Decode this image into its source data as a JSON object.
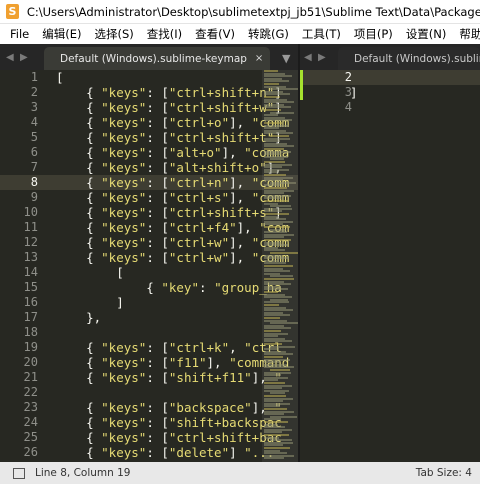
{
  "window": {
    "title": "C:\\Users\\Administrator\\Desktop\\sublimetextpj_jb51\\Sublime Text\\Data\\Packages\\Default\\D..."
  },
  "menu": [
    "File",
    "编辑(E)",
    "选择(S)",
    "查找(I)",
    "查看(V)",
    "转跳(G)",
    "工具(T)",
    "项目(P)",
    "设置(N)",
    "帮助(H)"
  ],
  "tabs": {
    "left": {
      "label": "Default (Windows).sublime-keymap",
      "close": "×"
    },
    "right": {
      "label": "Default (Windows).sublime-keym"
    },
    "arrows": {
      "left_prev": "◀",
      "left_next": "▶",
      "dropdown": "▼",
      "right_prev": "◀",
      "right_next": "▶"
    }
  },
  "left_pane": {
    "line_numbers": [
      "1",
      "2",
      "3",
      "4",
      "5",
      "6",
      "7",
      "8",
      "9",
      "10",
      "11",
      "12",
      "13",
      "14",
      "15",
      "16",
      "17",
      "18",
      "19",
      "20",
      "21",
      "22",
      "23",
      "24",
      "25",
      "26"
    ],
    "active_line": "8",
    "lines": [
      "[",
      "    { \"keys\": [\"ctrl+shift+n\"]",
      "    { \"keys\": [\"ctrl+shift+w\"]",
      "    { \"keys\": [\"ctrl+o\"], \"comm",
      "    { \"keys\": [\"ctrl+shift+t\"]",
      "    { \"keys\": [\"alt+o\"], \"comma",
      "    { \"keys\": [\"alt+shift+o\"],",
      "    { \"keys\": [\"ctrl+n\"], \"comm",
      "    { \"keys\": [\"ctrl+s\"], \"comm",
      "    { \"keys\": [\"ctrl+shift+s\"]",
      "    { \"keys\": [\"ctrl+f4\"], \"com",
      "    { \"keys\": [\"ctrl+w\"], \"comm",
      "    { \"keys\": [\"ctrl+w\"], \"comm",
      "        [",
      "            { \"key\": \"group_ha",
      "        ]",
      "    },",
      "",
      "    { \"keys\": [\"ctrl+k\", \"ctrl",
      "    { \"keys\": [\"f11\"], \"command",
      "    { \"keys\": [\"shift+f11\"], \"",
      "",
      "    { \"keys\": [\"backspace\"], \"",
      "    { \"keys\": [\"shift+backspac",
      "    { \"keys\": [\"ctrl+shift+bac",
      "    { \"keys\": [\"delete\"] \"..."
    ]
  },
  "right_pane": {
    "line_numbers": [
      "2",
      "3",
      "4"
    ],
    "active_line": "2",
    "lines": [
      "",
      "]",
      ""
    ]
  },
  "status": {
    "position": "Line 8, Column 19",
    "tab_size": "Tab Size: 4"
  },
  "colors": {
    "editor_bg": "#272822",
    "string": "#e6db74",
    "foreground": "#f8f8f2",
    "gutter_fg": "#8f908a",
    "modified": "#a6e22e"
  }
}
